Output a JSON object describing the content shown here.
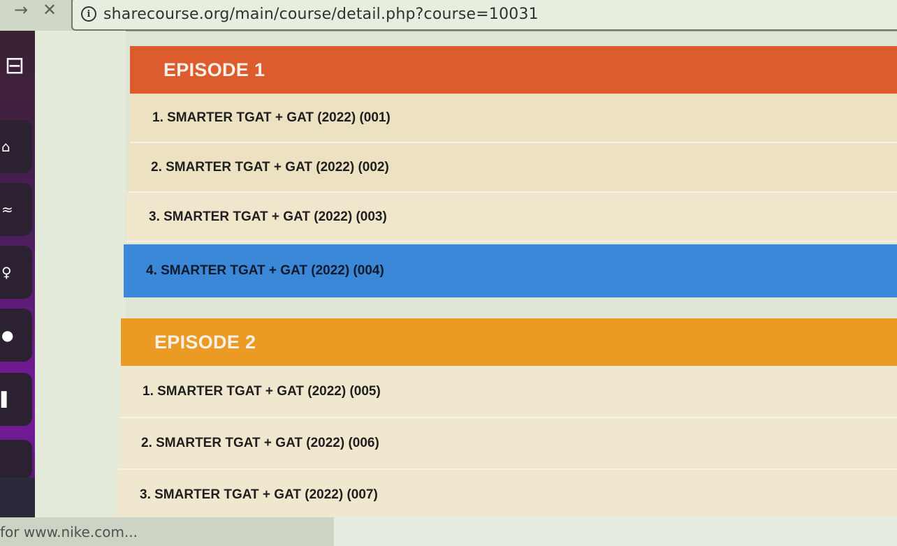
{
  "browser": {
    "forward_icon": "arrow-right-icon",
    "forward_glyph": "→",
    "stop_icon": "close-icon",
    "stop_glyph": "✕",
    "info_icon": "info-icon",
    "info_glyph": "i",
    "url": "sharecourse.org/main/course/detail.php?course=10031"
  },
  "sidebar": {
    "logo_icon": "presentation-board-icon",
    "logo_glyph": "⊟",
    "items": [
      {
        "icon": "home-icon",
        "glyph": "⌂"
      },
      {
        "icon": "graduation-cap-icon",
        "glyph": "≈"
      },
      {
        "icon": "user-icon",
        "glyph": "♀"
      },
      {
        "icon": "puzzle-icon",
        "glyph": "●"
      },
      {
        "icon": "menu-icon",
        "glyph": "▌"
      }
    ]
  },
  "episodes": [
    {
      "title": "EPISODE 1",
      "color": "#dd5c2e",
      "lessons": [
        "1. SMARTER TGAT + GAT (2022) (001)",
        "2. SMARTER TGAT + GAT (2022) (002)",
        "3. SMARTER TGAT + GAT (2022) (003)",
        "4. SMARTER TGAT + GAT (2022) (004)"
      ],
      "active_lesson": "4. SMARTER TGAT + GAT (2022) (004)"
    },
    {
      "title": "EPISODE 2",
      "color": "#eb9a24",
      "lessons": [
        "1. SMARTER TGAT + GAT (2022) (005)",
        "2. SMARTER TGAT + GAT (2022) (006)",
        "3. SMARTER TGAT + GAT (2022) (007)"
      ]
    }
  ],
  "status_bar": {
    "text": "for www.nike.com..."
  },
  "colors": {
    "active_row": "#3b87d8",
    "row_bg": "#ece2c2",
    "sidebar_accent": "#7a1aa0"
  }
}
